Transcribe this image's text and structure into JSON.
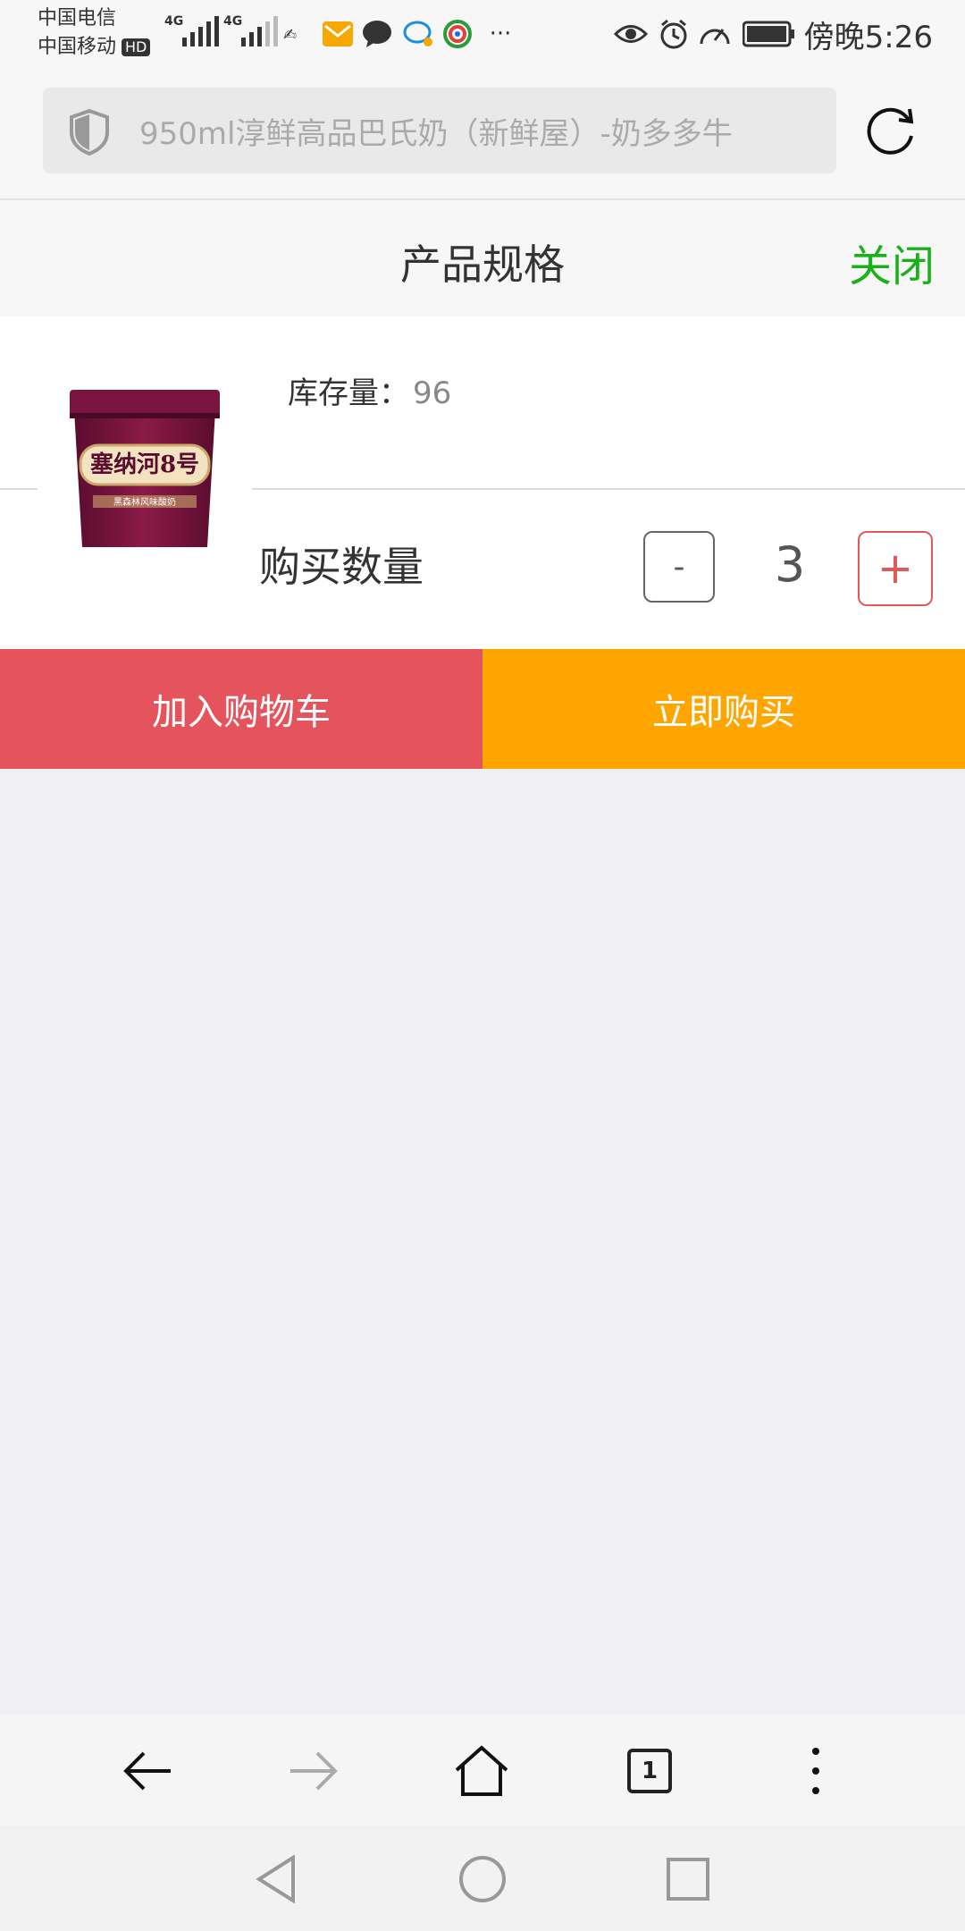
{
  "status_bar": {
    "carrier1": "中国电信",
    "carrier2": "中国移动",
    "hd": "HD",
    "network1": "4G",
    "network2": "4G",
    "time": "傍晚5:26",
    "more_indicator": "···"
  },
  "address_bar": {
    "url_text": "950ml淳鲜高品巴氏奶（新鲜屋）-奶多多牛",
    "shield_icon": "shield-icon",
    "reload_icon": "reload-icon"
  },
  "spec_panel": {
    "title": "产品规格",
    "close_label": "关闭",
    "stock_label": "库存量：",
    "stock_value": "96",
    "quantity_label": "购买数量",
    "quantity_value": "3",
    "minus_label": "-",
    "plus_label": "+"
  },
  "actions": {
    "add_to_cart": "加入购物车",
    "buy_now": "立即购买"
  },
  "product_image": {
    "brand": "塞纳河8号",
    "sub": "黑森林风味酸奶"
  },
  "browser_nav": {
    "tab_count": "1",
    "icons": [
      "back-arrow-icon",
      "forward-arrow-icon",
      "home-icon",
      "tabs-icon",
      "more-vertical-icon"
    ]
  },
  "system_nav": {
    "icons": [
      "back-triangle-icon",
      "home-circle-icon",
      "recents-square-icon"
    ]
  },
  "colors": {
    "close_green": "#1ab01a",
    "cart_red": "#e5545c",
    "buy_orange": "#ffa500",
    "plus_red": "#e05a5a",
    "background": "#efeff4"
  }
}
